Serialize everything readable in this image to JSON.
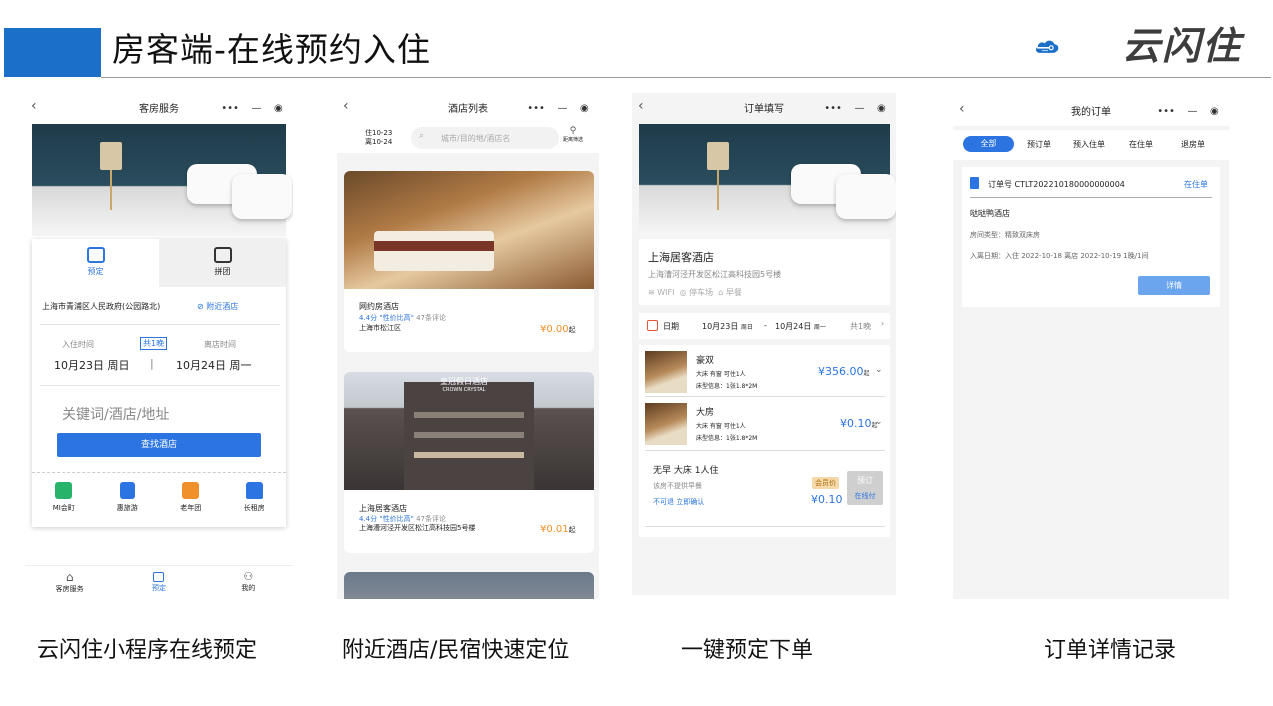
{
  "header": {
    "title": "房客端-在线预约入住",
    "logo_text": "云闪住"
  },
  "captions": [
    "云闪住小程序在线预定",
    "附近酒店/民宿快速定位",
    "一键预定下单",
    "订单详情记录"
  ],
  "capsule": {
    "more": "•••",
    "minus": "—",
    "target": "◉"
  },
  "phone1": {
    "title": "客房服务",
    "tabs": [
      {
        "label": "预定"
      },
      {
        "label": "拼团"
      }
    ],
    "location": "上海市青浦区人民政府(公园路北)",
    "nearby": "附近酒店",
    "checkin_label": "入住时间",
    "checkin_date": "10月23日 周日",
    "nights": "共1晚",
    "checkout_label": "离店时间",
    "checkout_date": "10月24日 周一",
    "divider": "|",
    "search_placeholder": "关键词/酒店/地址",
    "search_button": "查找酒店",
    "services": [
      {
        "label": "MI会町",
        "color": "#27b46a"
      },
      {
        "label": "惠旅游",
        "color": "#2b74e2"
      },
      {
        "label": "老年团",
        "color": "#f0902a"
      },
      {
        "label": "长租房",
        "color": "#2b74e2"
      }
    ],
    "bottom_nav": [
      {
        "label": "客房服务"
      },
      {
        "label": "预定"
      },
      {
        "label": "我的"
      }
    ]
  },
  "phone2": {
    "title": "酒店列表",
    "date_in": "住10-23",
    "date_out": "离10-24",
    "search_placeholder": "城市/目的地/酒店名",
    "filter_label": "距离筛选",
    "hotels": [
      {
        "name": "网约房酒店",
        "rating": "4.4分",
        "tag": "\"性价比高\"",
        "reviews": "47条评论",
        "address": "上海市松江区",
        "price": "¥0.00",
        "unit": "起"
      },
      {
        "name": "上海居客酒店",
        "rating": "4.4分",
        "tag": "\"性价比高\"",
        "reviews": "47条评论",
        "address": "上海漕河泾开发区松江高科技园5号楼",
        "price": "¥0.01",
        "unit": "起"
      }
    ],
    "sign_text": "皇冠假日酒店",
    "sign_en": "CROWN CRYSTAL"
  },
  "phone3": {
    "title": "订单填写",
    "hotel_name": "上海居客酒店",
    "address": "上海漕河泾开发区松江高科技园5号楼",
    "amenities": [
      "WIFI",
      "停车场",
      "早餐"
    ],
    "date_label": "日期",
    "date_in": "10月23日",
    "date_in_day": "周日",
    "date_sep": "-",
    "date_out": "10月24日",
    "date_out_day": "周一",
    "nights": "共1晚",
    "rooms": [
      {
        "name": "豪双",
        "desc": "大床 有窗 可住1人",
        "bed": "床型信息：1张1.8*2M",
        "price": "¥356.00",
        "unit": "起"
      },
      {
        "name": "大房",
        "desc": "大床 有窗 可住1人",
        "bed": "床型信息：1张1.8*2M",
        "price": "¥0.10",
        "unit": "起"
      }
    ],
    "package": {
      "title": "无早 大床 1人住",
      "note": "该房不提供早餐",
      "policy": "不可退 立即确认",
      "member": "会员价",
      "price": "¥0.10",
      "book": "预订",
      "book_sub": "在线付"
    }
  },
  "phone4": {
    "title": "我的订单",
    "tabs": [
      "全部",
      "预订单",
      "预入住单",
      "在住单",
      "退房单"
    ],
    "order_no": "订单号 CTLT202210180000000004",
    "status": "在住单",
    "hotel": "哒哒鸭酒店",
    "room_type": "房间类型：精致双床房",
    "dates": "入离日期：入住 2022-10-18 离店 2022-10-19 1晚/1间",
    "detail_button": "详情"
  }
}
